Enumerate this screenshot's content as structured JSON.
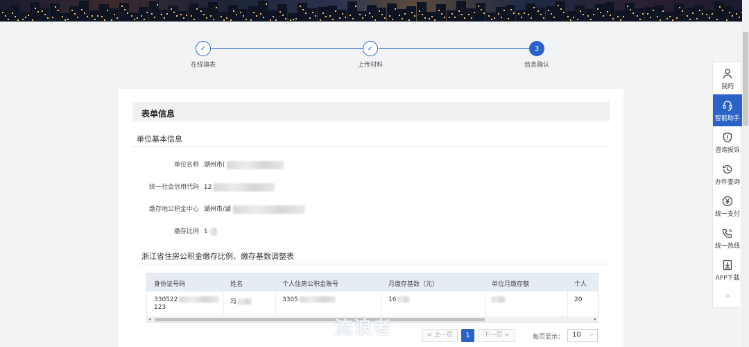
{
  "steps": [
    {
      "label": "在线填表",
      "state": "done",
      "mark": "✓"
    },
    {
      "label": "上传材料",
      "state": "done",
      "mark": "✓"
    },
    {
      "label": "信息确认",
      "state": "current",
      "mark": "3"
    }
  ],
  "form": {
    "section_title": "表单信息",
    "basic_title": "单位基本信息",
    "fields": [
      {
        "label": "单位名称",
        "value": "湖州市("
      },
      {
        "label": "统一社会信用代码",
        "value": "12"
      },
      {
        "label": "缴存地公积金中心",
        "value": "湖州市/湖"
      },
      {
        "label": "缴存比例",
        "value": "1"
      }
    ],
    "table_title": "浙江省住房公积金缴存比例、缴存基数调整表",
    "table": {
      "headers": [
        "身份证号码",
        "姓名",
        "个人住房公积金账号",
        "月缴存基数（元）",
        "单位月缴存额",
        "个人"
      ],
      "rows": [
        [
          "330522",
          "123",
          "冯",
          "3305",
          "16",
          "",
          "20"
        ]
      ]
    }
  },
  "pager": {
    "prev": "< 上一页",
    "page": "1",
    "next": "下一页 >",
    "per_page_label": "每页显示：",
    "per_page_value": "10"
  },
  "watermark": "流浪者",
  "sidebar": [
    {
      "label": "我的",
      "icon": "user-icon"
    },
    {
      "label": "智能助手",
      "icon": "headset-icon",
      "active": true
    },
    {
      "label": "咨询投诉",
      "icon": "shield-alert-icon"
    },
    {
      "label": "办件查询",
      "icon": "history-icon"
    },
    {
      "label": "统一支付",
      "icon": "yen-icon"
    },
    {
      "label": "统一热线",
      "icon": "phone-icon"
    },
    {
      "label": "APP下载",
      "icon": "download-icon"
    },
    {
      "label": "»",
      "icon": "double-chevron-icon"
    }
  ],
  "colors": {
    "accent": "#2a62c9",
    "header_bg": "#e6ecf4"
  }
}
